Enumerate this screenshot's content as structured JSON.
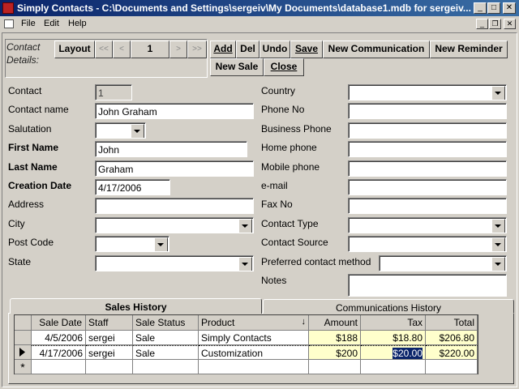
{
  "window": {
    "title": "Simply Contacts - C:\\Documents and Settings\\sergeiv\\My Documents\\database1.mdb for sergeiv..."
  },
  "menu": {
    "file": "File",
    "edit": "Edit",
    "help": "Help"
  },
  "toolbar": {
    "group_label_line1": "Contact",
    "group_label_line2": "Details:",
    "layout": "Layout",
    "first": "<<",
    "prev": "<",
    "record_number": "1",
    "next": ">",
    "last": ">>",
    "add": "Add",
    "del": "Del",
    "undo": "Undo",
    "save": "Save",
    "new_communication": "New Communication",
    "new_reminder": "New Reminder",
    "new_sale": "New Sale",
    "close": "Close"
  },
  "left_fields": {
    "contact": {
      "label": "Contact",
      "value": "1"
    },
    "contact_name": {
      "label": "Contact name",
      "value": "John Graham"
    },
    "salutation": {
      "label": "Salutation",
      "value": ""
    },
    "first_name": {
      "label": "First Name",
      "value": "John"
    },
    "last_name": {
      "label": "Last Name",
      "value": "Graham"
    },
    "creation_date": {
      "label": "Creation Date",
      "value": "4/17/2006"
    },
    "address": {
      "label": "Address",
      "value": ""
    },
    "city": {
      "label": "City",
      "value": ""
    },
    "post_code": {
      "label": "Post Code",
      "value": ""
    },
    "state": {
      "label": "State",
      "value": ""
    }
  },
  "right_fields": {
    "country": {
      "label": "Country",
      "value": ""
    },
    "phone_no": {
      "label": "Phone No",
      "value": ""
    },
    "business_phone": {
      "label": "Business Phone",
      "value": ""
    },
    "home_phone": {
      "label": "Home phone",
      "value": ""
    },
    "mobile_phone": {
      "label": "Mobile phone",
      "value": ""
    },
    "email": {
      "label": "e-mail",
      "value": ""
    },
    "fax_no": {
      "label": "Fax No",
      "value": ""
    },
    "contact_type": {
      "label": "Contact Type",
      "value": ""
    },
    "contact_source": {
      "label": "Contact Source",
      "value": ""
    },
    "preferred_method": {
      "label": "Preferred contact method",
      "value": ""
    },
    "notes": {
      "label": "Notes",
      "value": ""
    }
  },
  "tabs": {
    "sales_history": "Sales History",
    "communications_history": "Communications History"
  },
  "sales_grid": {
    "headers": {
      "sale_date": "Sale Date",
      "staff": "Staff",
      "sale_status": "Sale Status",
      "product": "Product",
      "amount": "Amount",
      "tax": "Tax",
      "total": "Total"
    },
    "rows": [
      {
        "sale_date": "4/5/2006",
        "staff": "sergei",
        "sale_status": "Sale",
        "product": "Simply Contacts",
        "amount": "$188",
        "tax": "$18.80",
        "total": "$206.80"
      },
      {
        "sale_date": "4/17/2006",
        "staff": "sergei",
        "sale_status": "Sale",
        "product": "Customization",
        "amount": "$200",
        "tax": "$20.00",
        "total": "$220.00"
      }
    ],
    "new_row_marker": "*"
  },
  "colors": {
    "titlebar": "#0a246a",
    "face": "#d4d0c8",
    "highlight": "#ffffcc",
    "selection": "#0a246a"
  }
}
